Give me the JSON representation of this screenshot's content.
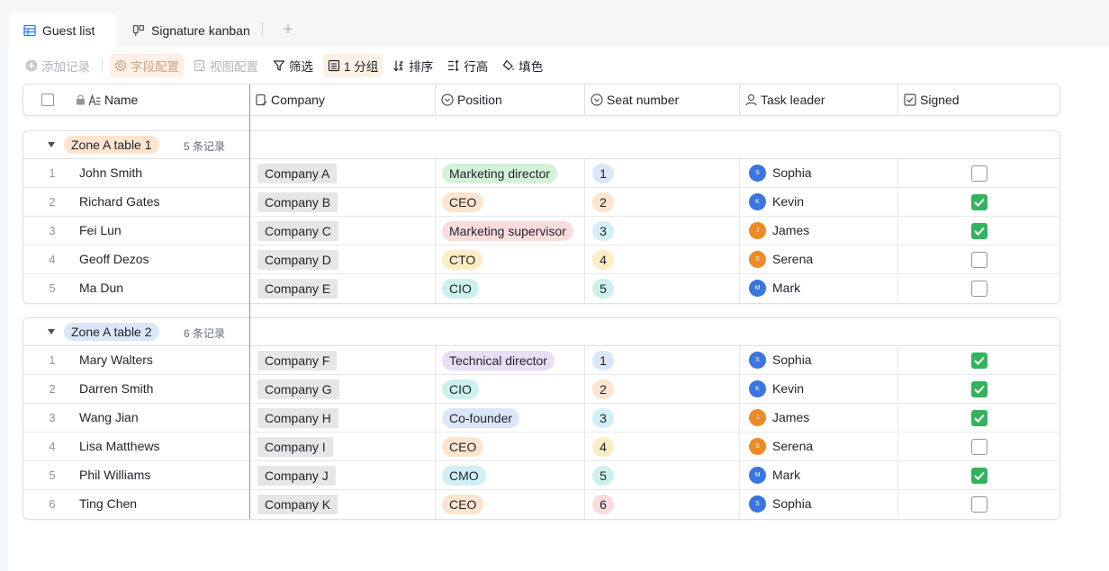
{
  "tabs": [
    {
      "label": "Guest list",
      "icon": "grid-table-icon"
    },
    {
      "label": "Signature kanban",
      "icon": "kanban-icon"
    }
  ],
  "tab_add": "+",
  "toolbar": {
    "add_record": "添加记录",
    "field_config": "字段配置",
    "view_config": "视图配置",
    "filter": "筛选",
    "group": "1 分组",
    "sort": "排序",
    "row_height": "行高",
    "fill": "填色"
  },
  "columns": {
    "name": "Name",
    "company": "Company",
    "position": "Position",
    "seat": "Seat number",
    "leader": "Task leader",
    "signed": "Signed"
  },
  "colors": {
    "sophia": "#3a75e0",
    "kevin": "#3a75e0",
    "james": "#ef8a27",
    "serena": "#ef8a27",
    "mark": "#3a75e0",
    "checked": "#33b35d"
  },
  "groups": [
    {
      "label": "Zone A table 1",
      "count": "5 条记录",
      "tag_color": "#fde4cf",
      "rows": [
        {
          "num": "1",
          "name": "John Smith",
          "company": "Company A",
          "position": "Marketing director",
          "pos_color": "#d4f2d8",
          "seat": "1",
          "seat_color": "#dce6f9",
          "leader": "Sophia",
          "initial": "S",
          "avatar": "#3a75e0",
          "signed": false
        },
        {
          "num": "2",
          "name": "Richard Gates",
          "company": "Company B",
          "position": "CEO",
          "pos_color": "#fde4cf",
          "seat": "2",
          "seat_color": "#fde4cf",
          "leader": "Kevin",
          "initial": "K",
          "avatar": "#3a75e0",
          "signed": true
        },
        {
          "num": "3",
          "name": "Fei Lun",
          "company": "Company C",
          "position": "Marketing supervisor",
          "pos_color": "#fbdcdc",
          "seat": "3",
          "seat_color": "#d2eef6",
          "leader": "James",
          "initial": "J",
          "avatar": "#ef8a27",
          "signed": true
        },
        {
          "num": "4",
          "name": "Geoff Dezos",
          "company": "Company D",
          "position": "CTO",
          "pos_color": "#fcedc4",
          "seat": "4",
          "seat_color": "#fcedc4",
          "leader": "Serena",
          "initial": "S",
          "avatar": "#ef8a27",
          "signed": false
        },
        {
          "num": "5",
          "name": "Ma Dun",
          "company": "Company E",
          "position": "CIO",
          "pos_color": "#cdf0ee",
          "seat": "5",
          "seat_color": "#cdf0ee",
          "leader": "Mark",
          "initial": "M",
          "avatar": "#3a75e0",
          "signed": false
        }
      ]
    },
    {
      "label": "Zone A table 2",
      "count": "6 条记录",
      "tag_color": "#dce6f9",
      "rows": [
        {
          "num": "1",
          "name": "Mary Walters",
          "company": "Company F",
          "position": "Technical director",
          "pos_color": "#e8dff7",
          "seat": "1",
          "seat_color": "#dce6f9",
          "leader": "Sophia",
          "initial": "S",
          "avatar": "#3a75e0",
          "signed": true
        },
        {
          "num": "2",
          "name": "Darren Smith",
          "company": "Company G",
          "position": "CIO",
          "pos_color": "#cdf0ee",
          "seat": "2",
          "seat_color": "#fde4cf",
          "leader": "Kevin",
          "initial": "K",
          "avatar": "#3a75e0",
          "signed": true
        },
        {
          "num": "3",
          "name": "Wang Jian",
          "company": "Company H",
          "position": "Co-founder",
          "pos_color": "#dce6f9",
          "seat": "3",
          "seat_color": "#d2eef6",
          "leader": "James",
          "initial": "J",
          "avatar": "#ef8a27",
          "signed": true
        },
        {
          "num": "4",
          "name": "Lisa Matthews",
          "company": "Company I",
          "position": "CEO",
          "pos_color": "#fde4cf",
          "seat": "4",
          "seat_color": "#fcedc4",
          "leader": "Serena",
          "initial": "S",
          "avatar": "#ef8a27",
          "signed": false
        },
        {
          "num": "5",
          "name": "Phil Williams",
          "company": "Company J",
          "position": "CMO",
          "pos_color": "#d2eef6",
          "seat": "5",
          "seat_color": "#cdf0ee",
          "leader": "Mark",
          "initial": "M",
          "avatar": "#3a75e0",
          "signed": true
        },
        {
          "num": "6",
          "name": "Ting Chen",
          "company": "Company K",
          "position": "CEO",
          "pos_color": "#fde4cf",
          "seat": "6",
          "seat_color": "#fbdcdc",
          "leader": "Sophia",
          "initial": "S",
          "avatar": "#3a75e0",
          "signed": false
        }
      ]
    }
  ]
}
